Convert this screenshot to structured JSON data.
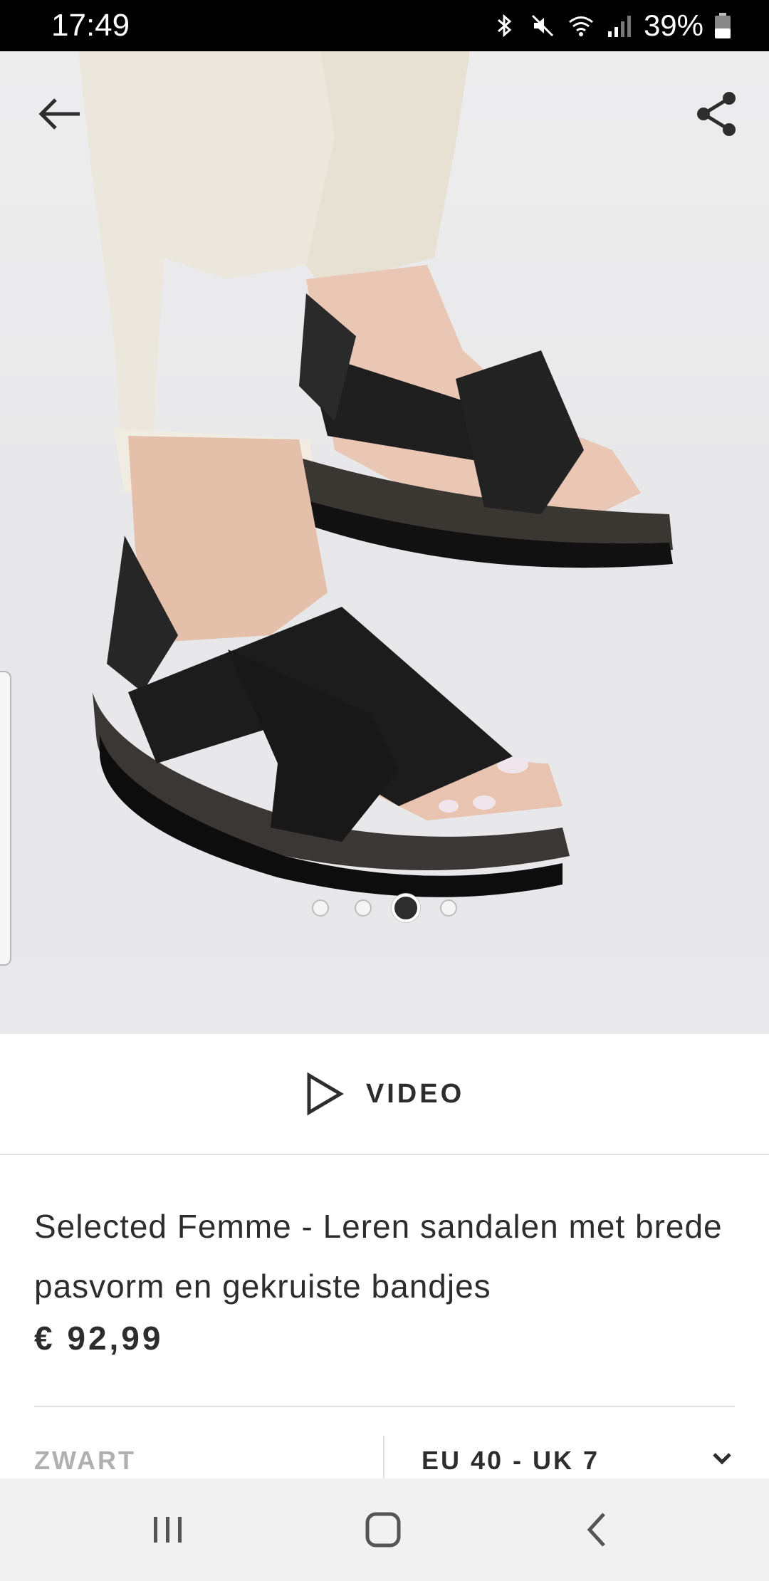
{
  "status_bar": {
    "time": "17:49",
    "battery": "39%",
    "icons": [
      "bluetooth-icon",
      "mute-icon",
      "wifi-icon",
      "signal-icon",
      "battery-icon"
    ]
  },
  "gallery": {
    "image_description_icon": "product-photo",
    "page_count": 4,
    "active_index": 2
  },
  "video": {
    "label": "VIDEO"
  },
  "product": {
    "title": "Selected Femme - Leren sandalen met brede pasvorm en gekruiste bandjes",
    "price": "€ 92,99"
  },
  "selectors": {
    "color": "ZWART",
    "size": "EU 40 - UK 7"
  },
  "colors": {
    "text": "#2d2d2d",
    "muted": "#b0b0b0",
    "image_bg": "#ececee"
  }
}
